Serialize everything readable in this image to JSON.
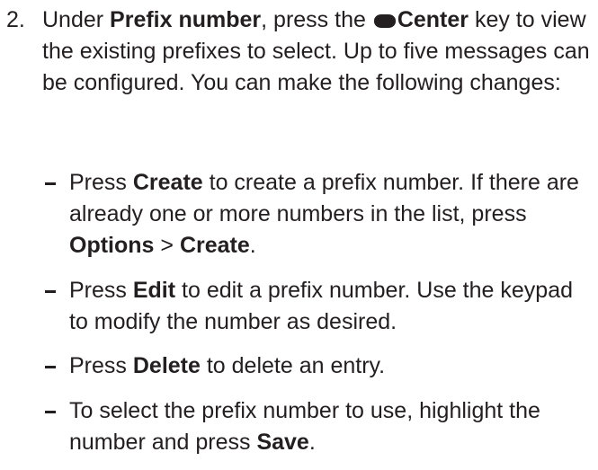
{
  "step": {
    "number": "2.",
    "intro": {
      "t1": "Under ",
      "b1": "Prefix number",
      "t2": ", press the ",
      "key_icon": "center-key-icon",
      "b2": "Center",
      "t3": " key to view the existing prefixes to select. Up to five messages can be configured. You can make the following changes:"
    }
  },
  "bullets": [
    {
      "t1": "Press ",
      "b1": "Create",
      "t2": " to create a prefix number. If there are already one or more numbers in the list, press ",
      "b2": "Options",
      "t3": " > ",
      "b3": "Create",
      "t4": "."
    },
    {
      "t1": "Press ",
      "b1": "Edit",
      "t2": " to edit a prefix number. Use the keypad to modify the number as desired."
    },
    {
      "t1": "Press ",
      "b1": "Delete",
      "t2": " to delete an entry."
    },
    {
      "t1": "To select the prefix number to use, highlight the number and press ",
      "b1": "Save",
      "t2": "."
    }
  ]
}
